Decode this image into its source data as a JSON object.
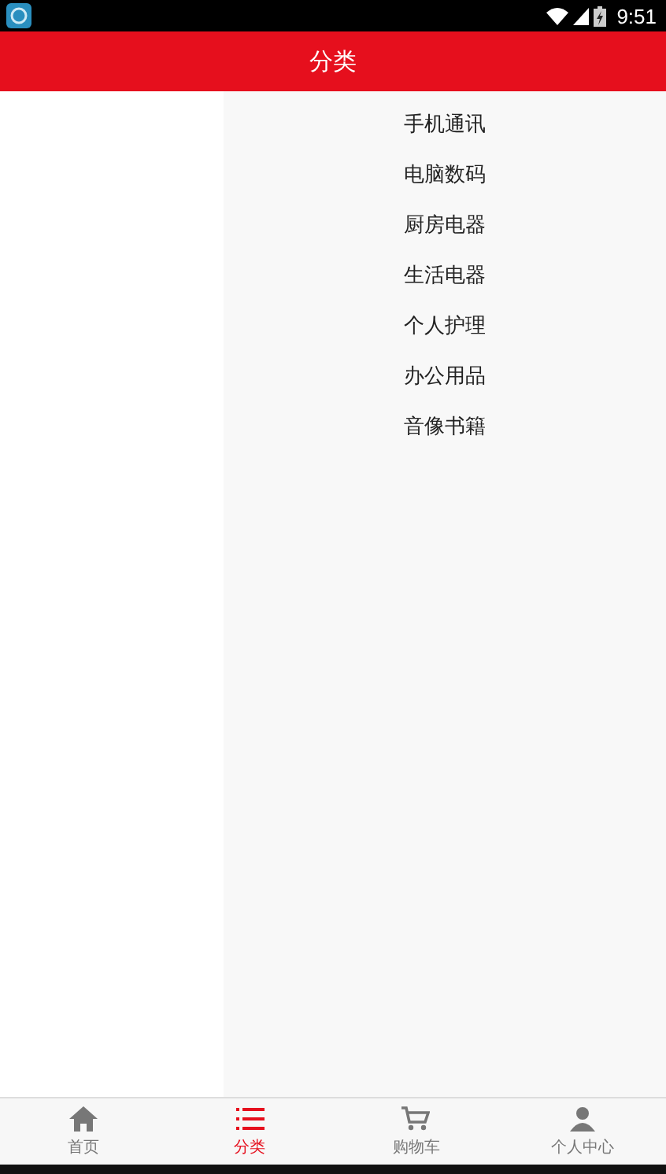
{
  "status_bar": {
    "time": "9:51"
  },
  "header": {
    "title": "分类"
  },
  "categories": [
    {
      "label": "手机通讯"
    },
    {
      "label": "电脑数码"
    },
    {
      "label": "厨房电器"
    },
    {
      "label": "生活电器"
    },
    {
      "label": "个人护理"
    },
    {
      "label": "办公用品"
    },
    {
      "label": "音像书籍"
    }
  ],
  "tabs": [
    {
      "label": "首页",
      "kind": "home",
      "selected": false
    },
    {
      "label": "分类",
      "kind": "list",
      "selected": true
    },
    {
      "label": "购物车",
      "kind": "cart",
      "selected": false
    },
    {
      "label": "个人中心",
      "kind": "person",
      "selected": false
    }
  ]
}
